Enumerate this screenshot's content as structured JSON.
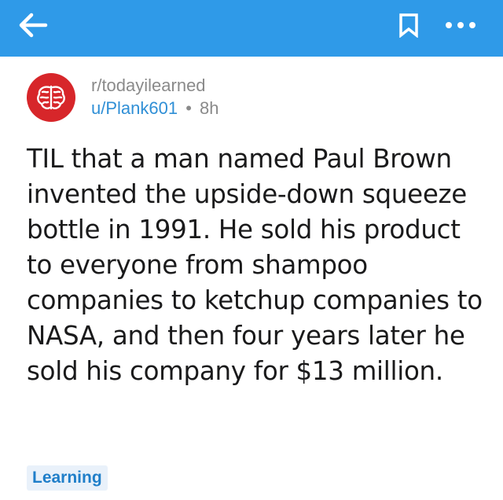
{
  "header": {
    "background_color": "#2f9ae8",
    "back_icon": "back-arrow-icon",
    "bookmark_icon": "bookmark-icon",
    "more_icon": "more-dots-icon"
  },
  "post": {
    "subreddit": "r/todayilearned",
    "author": "u/Plank601",
    "separator": "•",
    "age": "8h",
    "avatar_icon": "brain-icon",
    "avatar_color": "#d7262a",
    "title": "TIL that a man named Paul Brown invented the upside-down squeeze bottle in 1991. He sold his product to everyone from shampoo companies to ketchup companies to NASA, and then four years later he sold his company for $13 million.",
    "flair": "Learning"
  }
}
